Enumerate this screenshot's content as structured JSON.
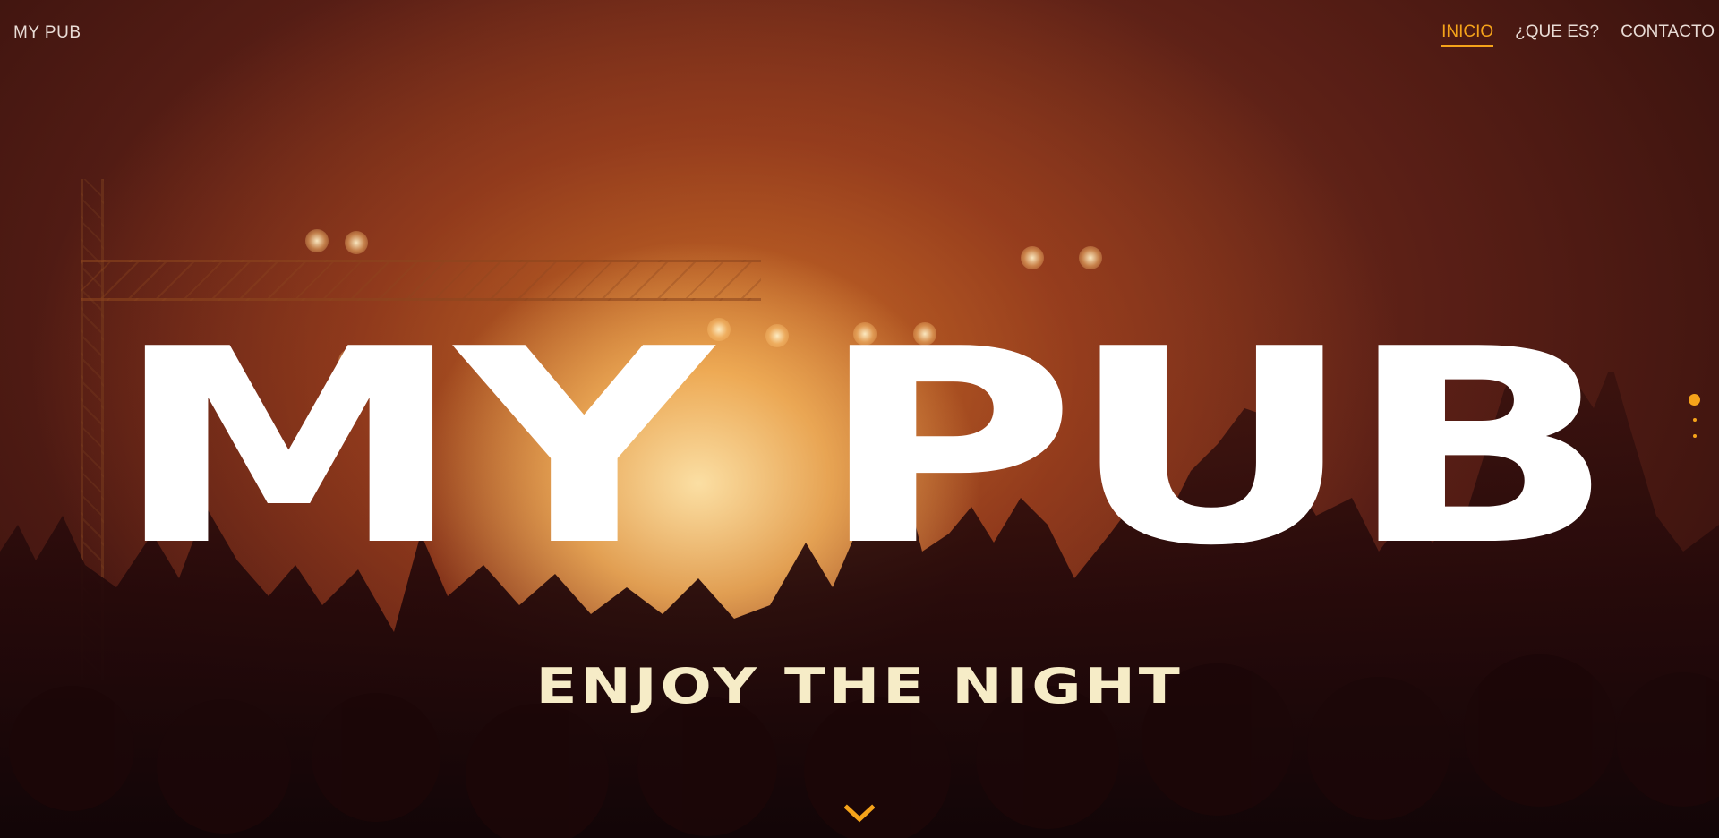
{
  "header": {
    "brand": "MY PUB",
    "nav": [
      {
        "label": "INICIO",
        "active": true
      },
      {
        "label": "¿QUE ES?",
        "active": false
      },
      {
        "label": "CONTACTO",
        "active": false
      }
    ]
  },
  "hero": {
    "title": "MY PUB",
    "tagline": "ENJOY THE NIGHT",
    "background": "concert crowd with raised hands and orange stage lights",
    "slide_count": 3,
    "active_slide": 1,
    "scroll_icon": "chevron-down-icon"
  },
  "colors": {
    "accent": "#f5a31a",
    "nav_text": "#e9dcd6",
    "title": "#ffffff",
    "tagline": "#f6ecc7"
  }
}
